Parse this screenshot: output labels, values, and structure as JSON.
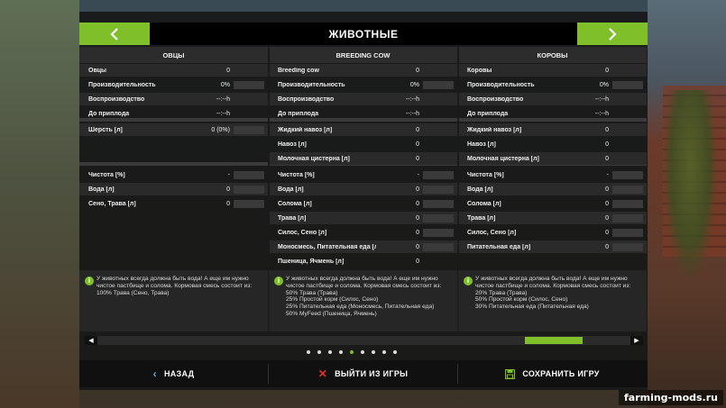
{
  "header": {
    "title": "ЖИВОТНЫЕ",
    "prev_icon": "chevron-left-icon",
    "next_icon": "chevron-right-icon"
  },
  "columns": [
    {
      "name": "ОВЦЫ",
      "rows": [
        {
          "label": "Овцы",
          "value": "0"
        },
        {
          "label": "Производительность",
          "value": "0%"
        },
        {
          "label": "Воспроизводство",
          "value": "--:--h"
        },
        {
          "label": "До приплода",
          "value": "--:--h"
        },
        {
          "label": "Шерсть [л]",
          "value": "0 (0%)"
        },
        {
          "label": "Чистота [%]",
          "value": "-"
        },
        {
          "label": "Вода [л]",
          "value": "0"
        },
        {
          "label": "Сено, Трава [л]",
          "value": "0"
        }
      ],
      "info": "У животных всегда должна быть вода! А еще им нужно чистое пастбище и солома. Кормовая смесь состоит из:\n100% Трава (Сено, Трава)"
    },
    {
      "name": "BREEDING COW",
      "rows": [
        {
          "label": "Breeding cow",
          "value": "0"
        },
        {
          "label": "Производительность",
          "value": "0%"
        },
        {
          "label": "Воспроизводство",
          "value": "--:--h"
        },
        {
          "label": "До приплода",
          "value": "--:--h"
        },
        {
          "label": "Жидкий навоз [л]",
          "value": "0"
        },
        {
          "label": "Навоз [л]",
          "value": "0"
        },
        {
          "label": "Молочная цистерна [л]",
          "value": "0"
        },
        {
          "label": "Чистота [%]",
          "value": "-"
        },
        {
          "label": "Вода [л]",
          "value": "0"
        },
        {
          "label": "Солома [л]",
          "value": "0"
        },
        {
          "label": "Трава [л]",
          "value": "0"
        },
        {
          "label": "Силос, Сено [л]",
          "value": "0"
        },
        {
          "label": "Моносмесь, Питательная еда [л]",
          "value": "0"
        },
        {
          "label": "Пшеница, Ячмень [л]",
          "value": "0"
        }
      ],
      "info": "У животных всегда должна быть вода! А еще им нужно чистое пастбище и солома. Кормовая смесь состоит из:\n50% Трава (Трава)\n25% Простой корм (Силос, Сено)\n25% Питательная еда (Моносмесь, Питательная еда)\n50% MyFeed (Пшеница, Ячмень)"
    },
    {
      "name": "КОРОВЫ",
      "rows": [
        {
          "label": "Коровы",
          "value": "0"
        },
        {
          "label": "Производительность",
          "value": "0%"
        },
        {
          "label": "Воспроизводство",
          "value": "--:--h"
        },
        {
          "label": "До приплода",
          "value": "--:--h"
        },
        {
          "label": "Жидкий навоз [л]",
          "value": "0"
        },
        {
          "label": "Навоз [л]",
          "value": "0"
        },
        {
          "label": "Молочная цистерна [л]",
          "value": "0"
        },
        {
          "label": "Чистота [%]",
          "value": "-"
        },
        {
          "label": "Вода [л]",
          "value": "0"
        },
        {
          "label": "Солома [л]",
          "value": "0"
        },
        {
          "label": "Трава [л]",
          "value": "0"
        },
        {
          "label": "Силос, Сено [л]",
          "value": "0"
        },
        {
          "label": "Питательная еда [л]",
          "value": "0"
        }
      ],
      "info": "У животных всегда должна быть вода! А еще им нужно чистое пастбище и солома. Кормовая смесь состоит из:\n20% Трава (Трава)\n50% Простой корм (Силос, Сено)\n30% Питательная еда (Питательная еда)"
    }
  ],
  "pager": {
    "count": 9,
    "active_index": 4
  },
  "scroll": {
    "position": 0.9
  },
  "footer": {
    "back_label": "НАЗАД",
    "quit_label": "ВЫЙТИ ИЗ ИГРЫ",
    "save_label": "СОХРАНИТЬ ИГРУ"
  },
  "watermark": "farming-mods.ru",
  "colors": {
    "accent": "#7fbf2a",
    "panel": "#181818",
    "quit_icon": "#e0302a"
  }
}
